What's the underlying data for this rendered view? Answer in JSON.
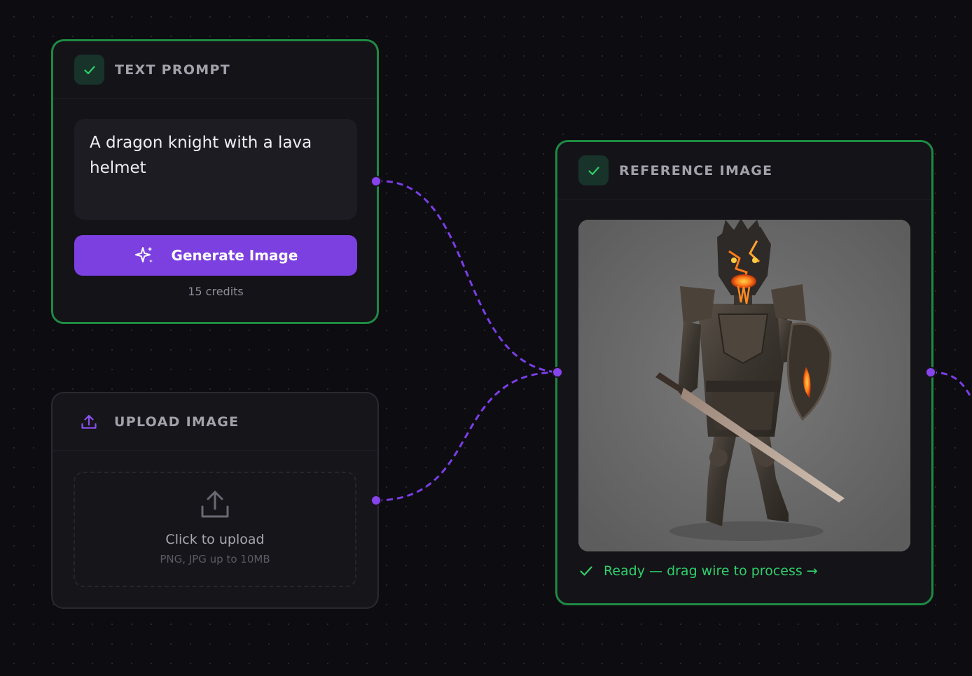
{
  "text_prompt_node": {
    "title": "TEXT PROMPT",
    "prompt_value": "A dragon knight with a lava helmet",
    "generate_label": "Generate Image",
    "credits": "15 credits"
  },
  "upload_node": {
    "title": "UPLOAD IMAGE",
    "drop_main": "Click to upload",
    "drop_sub": "PNG, JPG up to 10MB"
  },
  "reference_node": {
    "title": "REFERENCE IMAGE",
    "status": "Ready — drag wire to process →"
  },
  "icons": {
    "status_check": "check-icon",
    "upload_header": "upload-icon",
    "generate": "sparkles-icon",
    "drop": "upload-tray-icon"
  },
  "colors": {
    "canvas_bg": "#0d0c10",
    "node_bg": "#141318",
    "complete_border": "#1e8a43",
    "accent_purple": "#7c3fe0",
    "wire": "#8644ec",
    "success_text": "#2fcf6a"
  }
}
